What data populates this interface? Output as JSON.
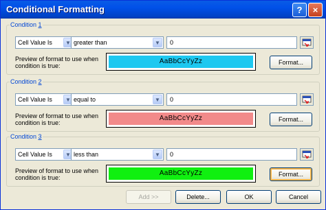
{
  "window": {
    "title": "Conditional Formatting",
    "help_glyph": "?",
    "close_glyph": "×"
  },
  "conditions": [
    {
      "label_prefix": "Condition ",
      "label_num": "1",
      "type": "Cell Value Is",
      "operator": "greater than",
      "value": "0",
      "preview_label": "Preview of format to use when condition is true:",
      "preview_text": "AaBbCcYyZz",
      "preview_color": "#1ec8f0",
      "format_label": "Format..."
    },
    {
      "label_prefix": "Condition ",
      "label_num": "2",
      "type": "Cell Value Is",
      "operator": "equal to",
      "value": "0",
      "preview_label": "Preview of format to use when condition is true:",
      "preview_text": "AaBbCcYyZz",
      "preview_color": "#f28a8a",
      "format_label": "Format..."
    },
    {
      "label_prefix": "Condition ",
      "label_num": "3",
      "type": "Cell Value Is",
      "operator": "less than",
      "value": "0",
      "preview_label": "Preview of format to use when condition is true:",
      "preview_text": "AaBbCcYyZz",
      "preview_color": "#10f010",
      "format_label": "Format..."
    }
  ],
  "buttons": {
    "add": "Add >>",
    "delete": "Delete...",
    "ok": "OK",
    "cancel": "Cancel"
  },
  "colors": {
    "title_bar": "#0050e8",
    "group_label": "#0046d5",
    "dialog_bg": "#ece9d8"
  }
}
